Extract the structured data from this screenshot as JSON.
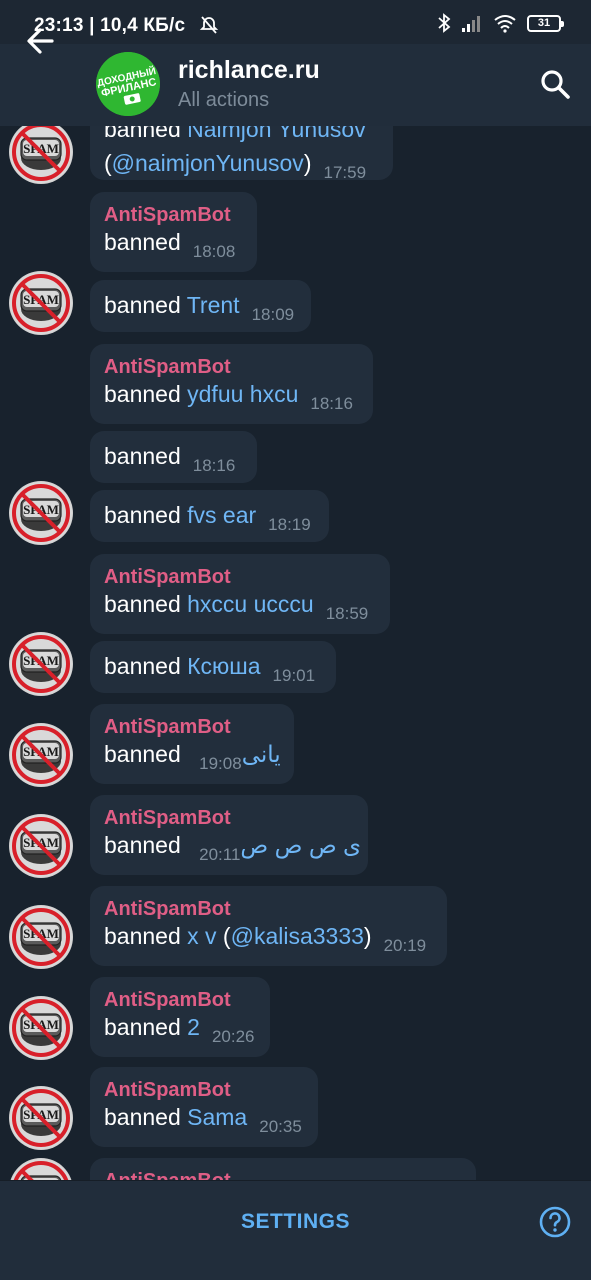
{
  "status_bar": {
    "time_text": "23:13 | 10,4 КБ/с",
    "battery": "31",
    "icons": [
      "alarm-off-icon",
      "bluetooth-icon",
      "signal-icon",
      "wifi-icon",
      "battery-icon"
    ]
  },
  "header": {
    "title": "richlance.ru",
    "subtitle": "All actions",
    "avatar_text_line1": "ДОХОДНЫЙ",
    "avatar_text_line2": "ФРИЛАНС"
  },
  "messages": [
    {
      "sender": "",
      "text": "banned ",
      "name": "Naimjon Yunusov",
      "line2": "(",
      "handle": "@naimjonYunusov",
      "line2_end": ")",
      "time": "17:59",
      "avatar": true
    },
    {
      "sender": "AntiSpamBot",
      "text": "banned",
      "name": "",
      "time": "18:08",
      "avatar": false
    },
    {
      "sender": "",
      "text": "banned ",
      "name": "Trent",
      "time": "18:09",
      "avatar": true
    },
    {
      "sender": "AntiSpamBot",
      "text": "banned ",
      "name": "ydfuu hxcu",
      "time": "18:16",
      "avatar": false
    },
    {
      "sender": "",
      "text": "banned",
      "name": "",
      "time": "18:16",
      "avatar": false
    },
    {
      "sender": "",
      "text": "banned ",
      "name": "fvs ear",
      "time": "18:19",
      "avatar": true
    },
    {
      "sender": "AntiSpamBot",
      "text": "banned ",
      "name": "hxccu ucccu",
      "time": "18:59",
      "avatar": false
    },
    {
      "sender": "",
      "text": "banned ",
      "name": "Ксюша",
      "time": "19:01",
      "avatar": true
    },
    {
      "sender": "AntiSpamBot",
      "text": "banned ",
      "name": "یانی",
      "time": "19:08",
      "avatar": true
    },
    {
      "sender": "AntiSpamBot",
      "text": "banned ",
      "name": "ی ص ص ص",
      "time": "20:11",
      "avatar": true
    },
    {
      "sender": "AntiSpamBot",
      "text": "banned ",
      "name": "x v",
      "extra_open": " (",
      "handle": "@kalisa3333",
      "extra_close": ")",
      "time": "20:19",
      "avatar": true
    },
    {
      "sender": "AntiSpamBot",
      "text": "banned ",
      "name": "2",
      "time": "20:26",
      "avatar": true
    },
    {
      "sender": "AntiSpamBot",
      "text": "banned ",
      "name": "Sama",
      "time": "20:35",
      "avatar": true
    },
    {
      "sender": "AntiSpamBot",
      "text": "",
      "name": "",
      "time": "",
      "avatar": true
    }
  ],
  "avatar_label": "SPAM",
  "bottom": {
    "settings_label": "SETTINGS"
  },
  "colors": {
    "background": "#18222d",
    "header": "#212d3b",
    "bubble": "#222e3c",
    "sender": "#e05e86",
    "link": "#6fb6f5",
    "accent": "#5fb0f3"
  }
}
